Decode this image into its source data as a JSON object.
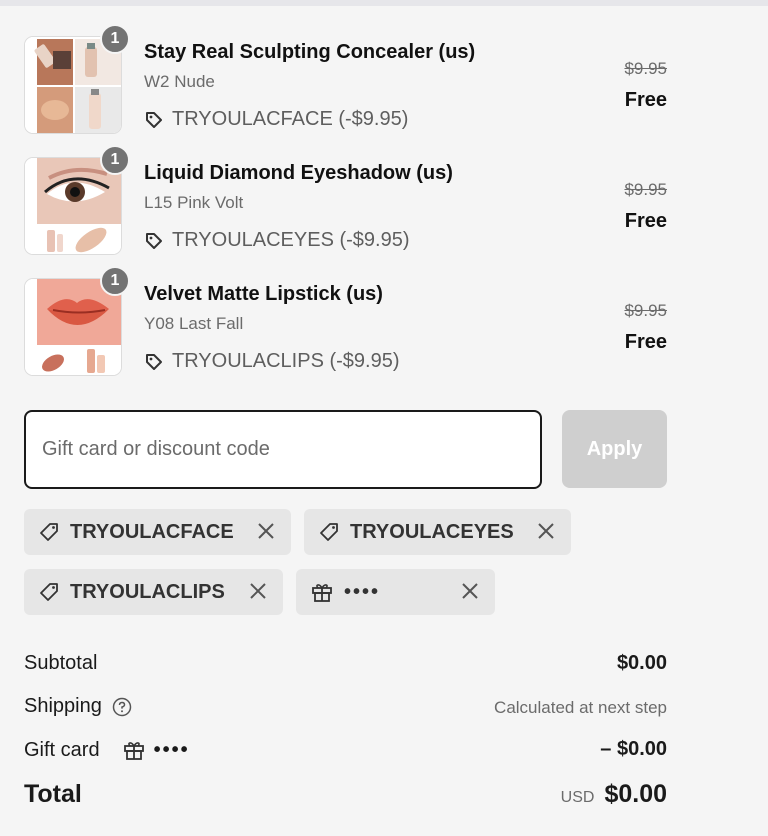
{
  "line_items": [
    {
      "quantity": "1",
      "name": "Stay Real Sculpting Concealer (us)",
      "variant": "W2 Nude",
      "discount": "TRYOULACFACE (-$9.95)",
      "original_price": "$9.95",
      "price": "Free",
      "image": "concealer-product-photo"
    },
    {
      "quantity": "1",
      "name": "Liquid Diamond Eyeshadow (us)",
      "variant": "L15 Pink Volt",
      "discount": "TRYOULACEYES (-$9.95)",
      "original_price": "$9.95",
      "price": "Free",
      "image": "eyeshadow-product-photo"
    },
    {
      "quantity": "1",
      "name": "Velvet Matte Lipstick (us)",
      "variant": "Y08 Last Fall",
      "discount": "TRYOULACLIPS (-$9.95)",
      "original_price": "$9.95",
      "price": "Free",
      "image": "lipstick-product-photo"
    }
  ],
  "discount_form": {
    "placeholder": "Gift card or discount code",
    "apply_label": "Apply"
  },
  "applied_codes": [
    {
      "label": "TRYOULACFACE",
      "icon": "tag-icon"
    },
    {
      "label": "TRYOULACEYES",
      "icon": "tag-icon"
    },
    {
      "label": "TRYOULACLIPS",
      "icon": "tag-icon"
    },
    {
      "label": "••••",
      "icon": "gift-icon"
    }
  ],
  "summary": {
    "subtotal_label": "Subtotal",
    "subtotal_value": "$0.00",
    "shipping_label": "Shipping",
    "shipping_value": "Calculated at next step",
    "gift_card_label": "Gift card",
    "gift_card_masked": "••••",
    "gift_card_value": "– $0.00",
    "total_label": "Total",
    "total_currency": "USD",
    "total_value": "$0.00"
  },
  "colors": {
    "background": "#f5f5f5",
    "apply_disabled": "#cfcfcf",
    "chip_background": "#e6e6e6",
    "badge": "#737373"
  }
}
